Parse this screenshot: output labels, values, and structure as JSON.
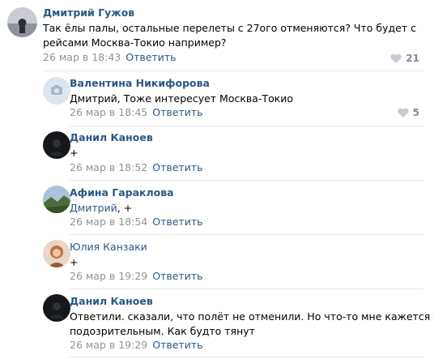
{
  "colors": {
    "link": "#2a5885",
    "meta": "#939393",
    "like": "#828a99",
    "divider": "#e7e8ec"
  },
  "comments": [
    {
      "author": "Дмитрий Гужов",
      "text_line1": "Так ёлы палы, остальные перелеты с 27ого отменяются? Что будет с",
      "text_line2": "рейсами Москва-Токио например?",
      "date": "26 мар в 18:43",
      "reply": "Ответить",
      "likes": "21",
      "avatar_icon": "user-photo-landscape"
    },
    {
      "author": "Валентина Никифорова",
      "text": "Дмитрий, Тоже интересует Москва-Токио",
      "date": "26 мар в 18:45",
      "reply": "Ответить",
      "likes": "5",
      "avatar_icon": "camera-placeholder-icon"
    },
    {
      "author": "Данил Каноев",
      "text": "+",
      "date": "26 мар в 18:52",
      "reply": "Ответить",
      "avatar_icon": "dark-photo-avatar"
    },
    {
      "author": "Афина Гараклова",
      "mention": "Дмитрий",
      "text_suffix": ", +",
      "date": "26 мар в 18:54",
      "reply": "Ответить",
      "avatar_icon": "landscape-photo-avatar"
    },
    {
      "author": "Юлия Канзаки",
      "text": "+",
      "date": "26 мар в 19:29",
      "reply": "Ответить",
      "avatar_icon": "portrait-photo-avatar"
    },
    {
      "author": "Данил Каноев",
      "text_line1": "Ответили. сказали, что полёт не отменили. Но что-то мне кажется это",
      "text_line2": "подозрительным. Как будто тянут",
      "date": "26 мар в 19:29",
      "reply": "Ответить",
      "avatar_icon": "dark-photo-avatar"
    }
  ]
}
